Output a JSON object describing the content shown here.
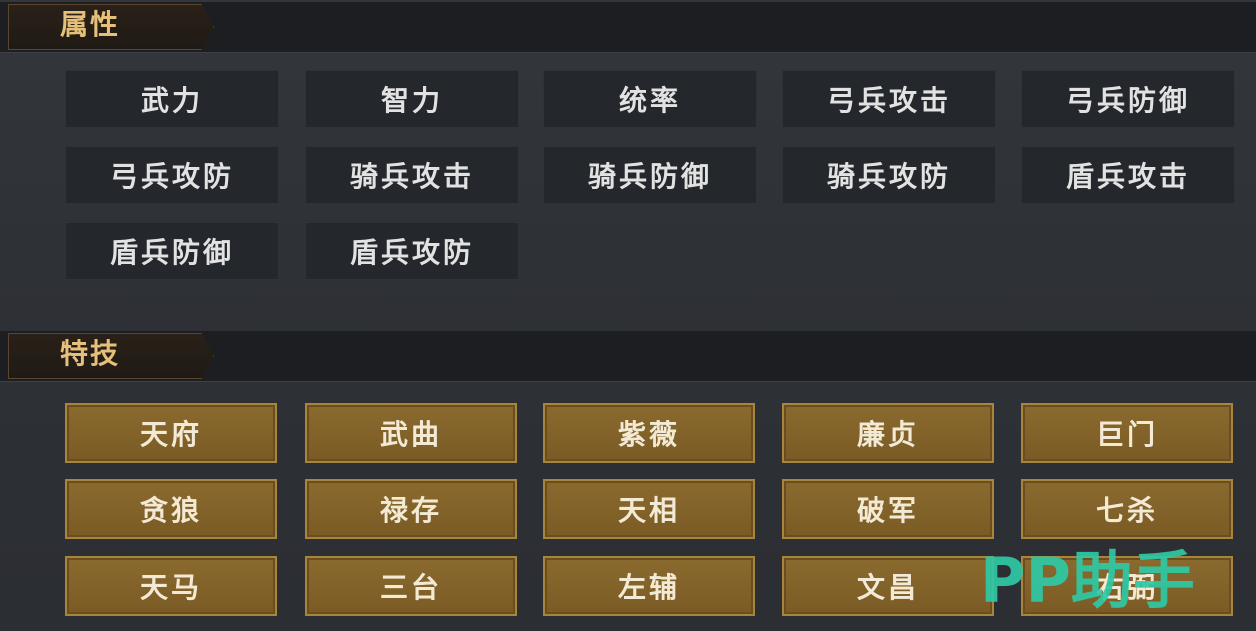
{
  "sections": {
    "attributes": {
      "title": "属性"
    },
    "skills": {
      "title": "特技"
    }
  },
  "attributes": [
    "武力",
    "智力",
    "统率",
    "弓兵攻击",
    "弓兵防御",
    "弓兵攻防",
    "骑兵攻击",
    "骑兵防御",
    "骑兵攻防",
    "盾兵攻击",
    "盾兵防御",
    "盾兵攻防"
  ],
  "skills": [
    "天府",
    "武曲",
    "紫薇",
    "廉贞",
    "巨门",
    "贪狼",
    "禄存",
    "天相",
    "破军",
    "七杀",
    "天马",
    "三台",
    "左辅",
    "文昌",
    "右弼"
  ],
  "watermark": {
    "text": "PP助手"
  },
  "colors": {
    "gold": "#e6c07a",
    "skill_bg": "#8a6a2e",
    "attr_bg": "#24272c",
    "watermark": "#2fc9a6"
  }
}
